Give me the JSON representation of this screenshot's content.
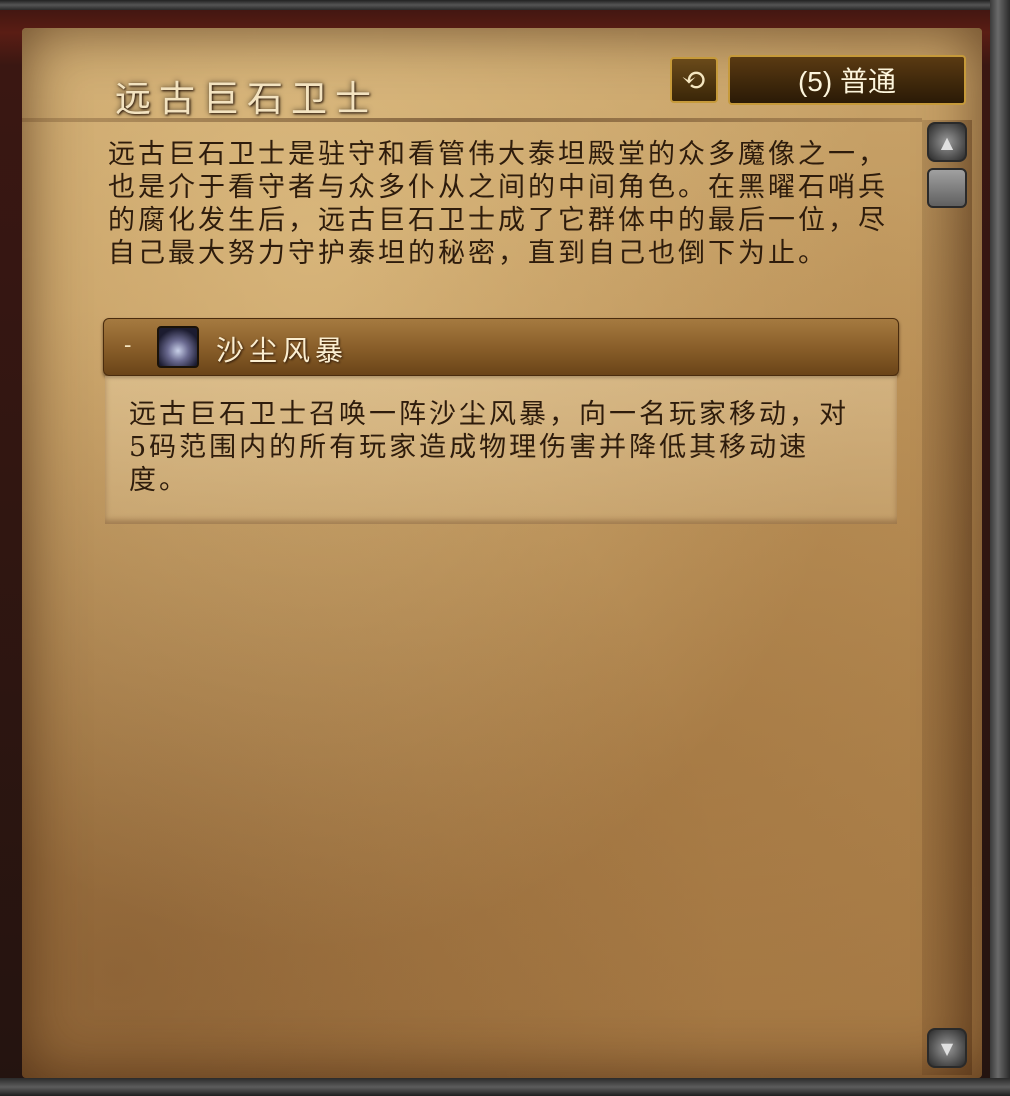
{
  "header": {
    "title": "远古巨石卫士",
    "reset_icon": "undo-arrow-icon",
    "difficulty_label": "(5) 普通"
  },
  "description": "远古巨石卫士是驻守和看管伟大泰坦殿堂的众多魔像之一，也是介于看守者与众多仆从之间的中间角色。在黑曜石哨兵的腐化发生后，远古巨石卫士成了它群体中的最后一位，尽自己最大努力守护泰坦的秘密，直到自己也倒下为止。",
  "ability": {
    "toggle": "-",
    "icon": "sandstorm-ability-icon",
    "name": "沙尘风暴",
    "description": "远古巨石卫士召唤一阵沙尘风暴，向一名玩家移动，对5码范围内的所有玩家造成物理伤害并降低其移动速度。"
  },
  "scrollbar": {
    "up_icon": "scroll-up-icon",
    "down_icon": "scroll-down-icon"
  },
  "colors": {
    "parchment": "#bf965c",
    "title_text": "#f3e3c0",
    "body_text": "#2e1c0c",
    "button_border": "#c69a3a"
  }
}
